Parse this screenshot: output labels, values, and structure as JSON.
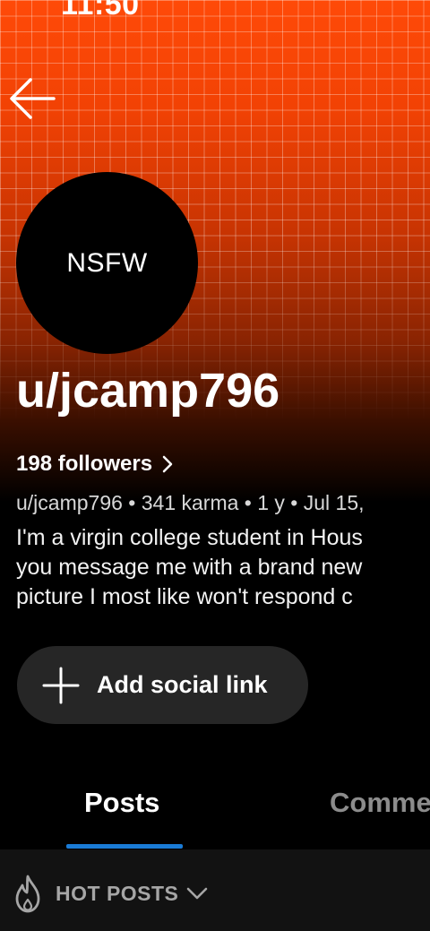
{
  "status": {
    "time": "11:50"
  },
  "profile": {
    "avatar_text": "NSFW",
    "username": "u/jcamp796",
    "followers": "198 followers",
    "meta": "u/jcamp796 • 341 karma • 1 y • Jul 15,",
    "bio_lines": [
      "I'm a virgin college student in Hous",
      "you message me with a brand new",
      "picture I most like won't respond c"
    ]
  },
  "actions": {
    "add_social_link": "Add social link"
  },
  "tabs": [
    {
      "label": "Posts",
      "active": true
    },
    {
      "label": "Comme",
      "active": false
    }
  ],
  "sort": {
    "label": "HOT POSTS",
    "icon": "flame-icon"
  },
  "colors": {
    "banner_top": "#ff4a08",
    "background": "#000000",
    "tab_indicator": "#1a7bd6",
    "chip_bg": "#262626"
  }
}
